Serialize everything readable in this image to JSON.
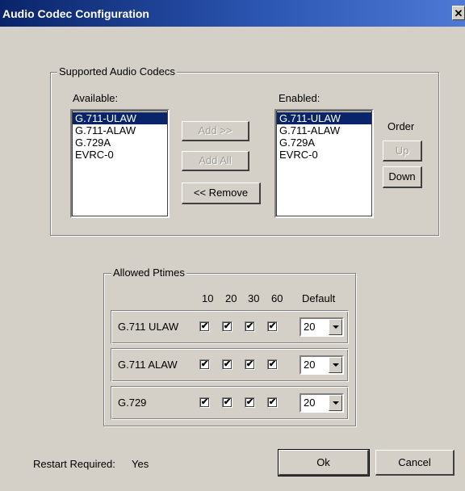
{
  "window": {
    "title": "Audio Codec Configuration",
    "close_glyph": "✕"
  },
  "supported_group": {
    "legend": "Supported Audio Codecs",
    "available_label": "Available:",
    "available_items": [
      "G.711-ULAW",
      "G.711-ALAW",
      "G.729A",
      "EVRC-0"
    ],
    "available_selected": "G.711-ULAW",
    "enabled_label": "Enabled:",
    "enabled_items": [
      "G.711-ULAW",
      "G.711-ALAW",
      "G.729A",
      "EVRC-0"
    ],
    "enabled_selected": "G.711-ULAW",
    "add_label": "Add >>",
    "add_all_label": "Add All",
    "remove_label": "<< Remove",
    "order_label": "Order",
    "up_label": "Up",
    "down_label": "Down"
  },
  "ptimes_group": {
    "legend": "Allowed Ptimes",
    "columns": [
      "10",
      "20",
      "30",
      "60"
    ],
    "default_label": "Default",
    "check_glyph": "✔",
    "rows": [
      {
        "codec": "G.711 ULAW",
        "checked": [
          true,
          true,
          true,
          true
        ],
        "default": "20"
      },
      {
        "codec": "G.711 ALAW",
        "checked": [
          true,
          true,
          true,
          true
        ],
        "default": "20"
      },
      {
        "codec": "G.729",
        "checked": [
          true,
          true,
          true,
          true
        ],
        "default": "20"
      }
    ]
  },
  "footer": {
    "restart_label": "Restart Required:",
    "restart_value": "Yes",
    "ok_label": "Ok",
    "cancel_label": "Cancel"
  }
}
